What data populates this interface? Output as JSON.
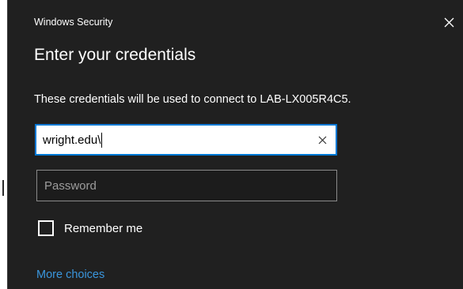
{
  "window": {
    "title": "Windows Security",
    "close_glyph": "✕"
  },
  "dialog": {
    "heading": "Enter your credentials",
    "description": "These credentials will be used to connect to LAB-LX005R4C5."
  },
  "username": {
    "value": "wright.edu\\",
    "clear_glyph": "✕"
  },
  "password": {
    "placeholder": "Password"
  },
  "remember_me": {
    "label": "Remember me",
    "checked": false
  },
  "more_choices": {
    "label": "More choices"
  },
  "colors": {
    "dialog_background": "#202020",
    "accent": "#0078d4",
    "link": "#3a96dd"
  },
  "icons": [
    "close-icon",
    "clear-text-icon"
  ]
}
